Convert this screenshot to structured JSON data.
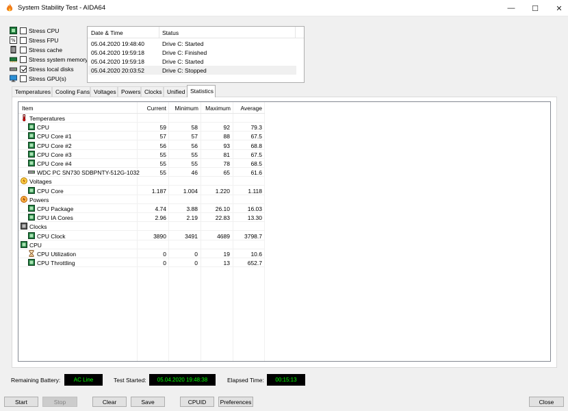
{
  "window": {
    "title": "System Stability Test - AIDA64",
    "controls": {
      "minimize": "—",
      "maximize": "☐",
      "close": "✕"
    }
  },
  "stress_options": [
    {
      "label": "Stress CPU",
      "checked": false,
      "icon": "cpu-icon"
    },
    {
      "label": "Stress FPU",
      "checked": false,
      "icon": "fpu-icon"
    },
    {
      "label": "Stress cache",
      "checked": false,
      "icon": "cache-icon"
    },
    {
      "label": "Stress system memory",
      "checked": false,
      "icon": "memory-icon"
    },
    {
      "label": "Stress local disks",
      "checked": true,
      "icon": "disk-icon"
    },
    {
      "label": "Stress GPU(s)",
      "checked": false,
      "icon": "monitor-icon"
    }
  ],
  "log": {
    "columns": [
      "Date & Time",
      "Status"
    ],
    "rows": [
      {
        "time": "05.04.2020 19:48:40",
        "status": "Drive C: Started"
      },
      {
        "time": "05.04.2020 19:59:18",
        "status": "Drive C: Finished"
      },
      {
        "time": "05.04.2020 19:59:18",
        "status": "Drive C: Started"
      },
      {
        "time": "05.04.2020 20:03:52",
        "status": "Drive C: Stopped"
      }
    ]
  },
  "tabs": [
    "Temperatures",
    "Cooling Fans",
    "Voltages",
    "Powers",
    "Clocks",
    "Unified",
    "Statistics"
  ],
  "active_tab": "Statistics",
  "stats": {
    "columns": [
      "Item",
      "Current",
      "Minimum",
      "Maximum",
      "Average"
    ],
    "rows": [
      {
        "type": "group",
        "icon": "thermometer-icon",
        "item": "Temperatures"
      },
      {
        "type": "item",
        "icon": "chip-icon",
        "item": "CPU",
        "current": "59",
        "minimum": "58",
        "maximum": "92",
        "average": "79.3"
      },
      {
        "type": "item",
        "icon": "chip-icon",
        "item": "CPU Core #1",
        "current": "57",
        "minimum": "57",
        "maximum": "88",
        "average": "67.5"
      },
      {
        "type": "item",
        "icon": "chip-icon",
        "item": "CPU Core #2",
        "current": "56",
        "minimum": "56",
        "maximum": "93",
        "average": "68.8"
      },
      {
        "type": "item",
        "icon": "chip-icon",
        "item": "CPU Core #3",
        "current": "55",
        "minimum": "55",
        "maximum": "81",
        "average": "67.5"
      },
      {
        "type": "item",
        "icon": "chip-icon",
        "item": "CPU Core #4",
        "current": "55",
        "minimum": "55",
        "maximum": "78",
        "average": "68.5"
      },
      {
        "type": "item",
        "icon": "drive-icon",
        "item": "WDC PC SN730 SDBPNTY-512G-1032",
        "current": "55",
        "minimum": "46",
        "maximum": "65",
        "average": "61.6"
      },
      {
        "type": "group",
        "icon": "voltage-icon",
        "item": "Voltages"
      },
      {
        "type": "item",
        "icon": "chip-icon",
        "item": "CPU Core",
        "current": "1.187",
        "minimum": "1.004",
        "maximum": "1.220",
        "average": "1.118"
      },
      {
        "type": "group",
        "icon": "power-icon",
        "item": "Powers"
      },
      {
        "type": "item",
        "icon": "chip-icon",
        "item": "CPU Package",
        "current": "4.74",
        "minimum": "3.88",
        "maximum": "26.10",
        "average": "16.03"
      },
      {
        "type": "item",
        "icon": "chip-icon",
        "item": "CPU IA Cores",
        "current": "2.96",
        "minimum": "2.19",
        "maximum": "22.83",
        "average": "13.30"
      },
      {
        "type": "group",
        "icon": "clock-icon",
        "item": "Clocks"
      },
      {
        "type": "item",
        "icon": "chip-icon",
        "item": "CPU Clock",
        "current": "3890",
        "minimum": "3491",
        "maximum": "4689",
        "average": "3798.7"
      },
      {
        "type": "group",
        "icon": "chip-icon",
        "item": "CPU"
      },
      {
        "type": "item",
        "icon": "hourglass-icon",
        "item": "CPU Utilization",
        "current": "0",
        "minimum": "0",
        "maximum": "19",
        "average": "10.6"
      },
      {
        "type": "item",
        "icon": "chip-icon",
        "item": "CPU Throttling",
        "current": "0",
        "minimum": "0",
        "maximum": "13",
        "average": "652.7"
      }
    ]
  },
  "status": {
    "battery_label": "Remaining Battery:",
    "battery_value": "AC Line",
    "started_label": "Test Started:",
    "started_value": "05.04.2020 19:48:38",
    "elapsed_label": "Elapsed Time:",
    "elapsed_value": "00:15:13"
  },
  "buttons": {
    "start": "Start",
    "stop": "Stop",
    "clear": "Clear",
    "save": "Save",
    "cpuid": "CPUID",
    "preferences": "Preferences",
    "close": "Close"
  },
  "colors": {
    "status_text": "#00ff00",
    "chip_green": "#1e7a3c",
    "selected_row": "#f0f0f0"
  }
}
